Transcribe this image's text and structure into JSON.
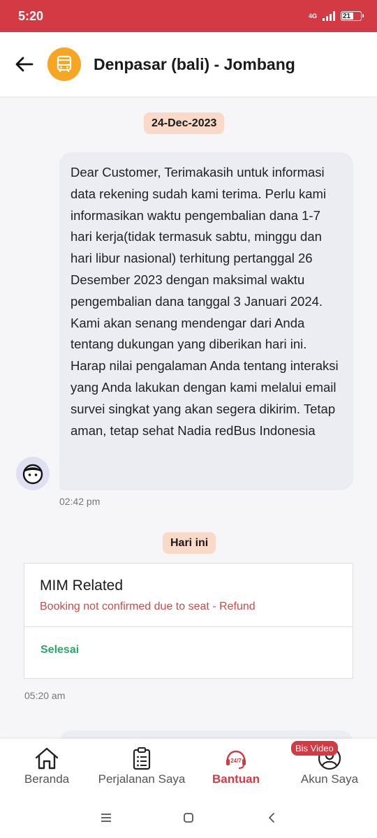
{
  "status_bar": {
    "time": "5:20",
    "network": "4G",
    "battery": "21"
  },
  "header": {
    "title": "Denpasar (bali) - Jombang",
    "back_icon": "arrow-left-icon",
    "avatar_icon": "bus-icon"
  },
  "chat": {
    "date_chip": "24-Dec-2023",
    "message": "Dear Customer, Terimakasih untuk informasi data rekening sudah kami terima. Perlu kami informasikan waktu pengembalian dana 1-7 hari kerja(tidak termasuk sabtu, minggu dan hari libur nasional) terhitung pertanggal 26 Desember 2023 dengan maksimal waktu pengembalian dana tanggal 3 Januari 2024. Kami akan senang mendengar dari Anda tentang dukungan yang diberikan hari ini. Harap nilai pengalaman Anda tentang interaksi yang Anda lakukan dengan kami melalui email survei singkat yang akan segera dikirim. Tetap aman, tetap sehat Nadia redBus Indonesia",
    "message_time": "02:42 pm",
    "today_chip": "Hari ini",
    "ticket": {
      "title": "MIM Related",
      "subtitle": "Booking not confirmed due to seat - Refund",
      "status": "Selesai"
    },
    "ticket_time": "05:20 am"
  },
  "bottom_nav": {
    "items": [
      {
        "label": "Beranda",
        "icon": "home-icon"
      },
      {
        "label": "Perjalanan Saya",
        "icon": "clipboard-icon"
      },
      {
        "label": "Bantuan",
        "icon": "support-247-icon"
      },
      {
        "label": "Akun Saya",
        "icon": "user-icon"
      }
    ],
    "badge": "Bis Video"
  },
  "colors": {
    "brand": "#d43a44",
    "bus_avatar": "#f6a623",
    "chip": "#f9d9c8",
    "bubble": "#ececf3",
    "success": "#2aa86a"
  }
}
